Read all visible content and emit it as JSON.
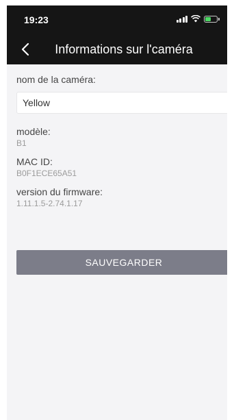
{
  "status_bar": {
    "time": "19:23"
  },
  "nav": {
    "title": "Informations sur l'caméra"
  },
  "camera_name": {
    "label": "nom de la caméra:",
    "value": "Yellow"
  },
  "model": {
    "label": "modèle:",
    "value": "B1"
  },
  "mac": {
    "label": "MAC ID:",
    "value": "B0F1ECE65A51"
  },
  "firmware": {
    "label": "version du firmware:",
    "value": "1.11.1.5-2.74.1.17"
  },
  "save_button": {
    "label": "SAUVEGARDER"
  },
  "colors": {
    "header_bg": "#151515",
    "page_bg": "#f4f4f6",
    "button_bg": "#7c7d89",
    "battery_fill": "#4cd964"
  },
  "icons": {
    "back": "chevron-left-icon",
    "signal": "cellular-signal-icon",
    "wifi": "wifi-icon",
    "battery": "battery-charging-icon"
  }
}
